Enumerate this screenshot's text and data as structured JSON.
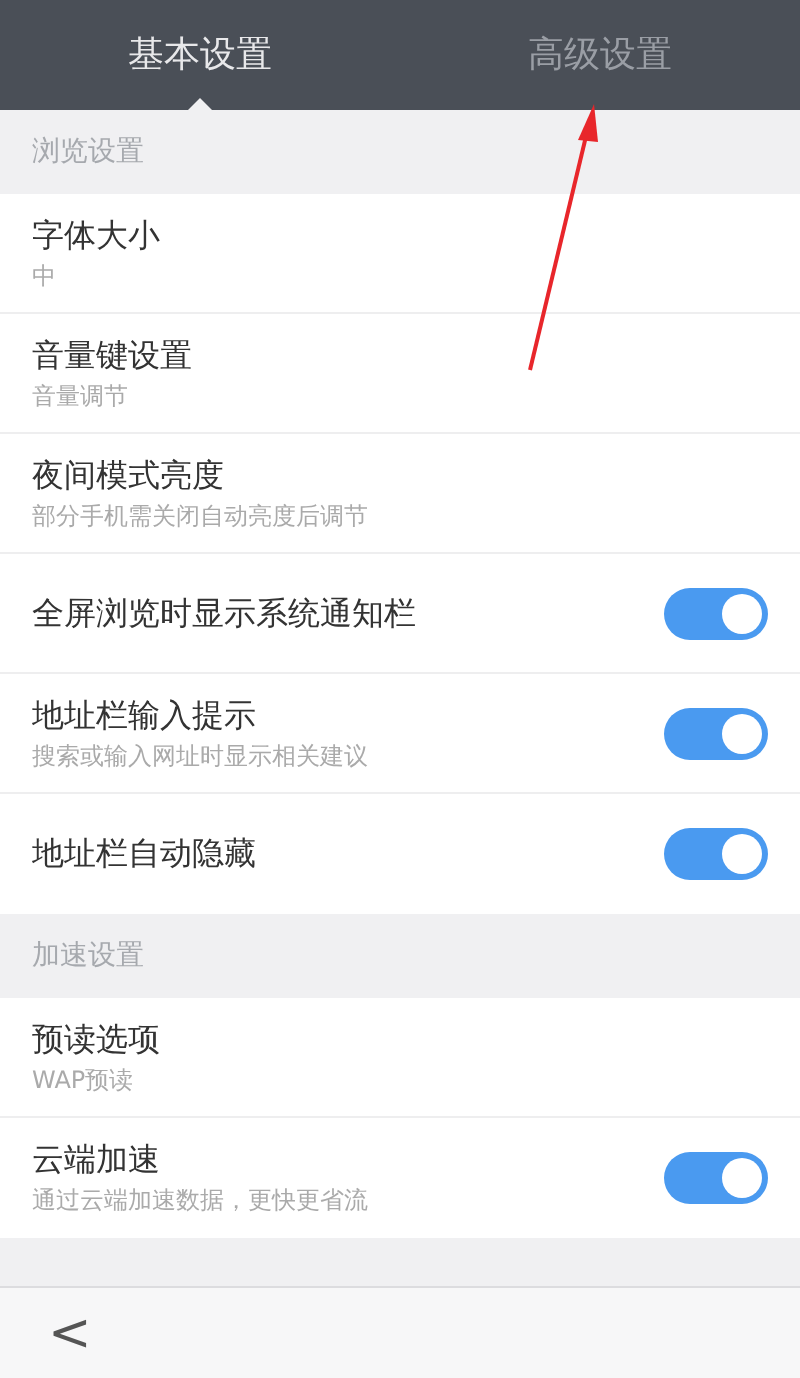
{
  "tabs": [
    {
      "label": "基本设置",
      "selected": true
    },
    {
      "label": "高级设置",
      "selected": false
    }
  ],
  "sections": [
    {
      "title": "浏览设置",
      "items": [
        {
          "kind": "nav",
          "label": "字体大小",
          "subtitle": "中"
        },
        {
          "kind": "nav",
          "label": "音量键设置",
          "subtitle": "音量调节"
        },
        {
          "kind": "nav",
          "label": "夜间模式亮度",
          "subtitle": "部分手机需关闭自动亮度后调节"
        },
        {
          "kind": "toggle",
          "label": "全屏浏览时显示系统通知栏",
          "on": true
        },
        {
          "kind": "toggle",
          "label": "地址栏输入提示",
          "subtitle": "搜索或输入网址时显示相关建议",
          "on": true
        },
        {
          "kind": "toggle",
          "label": "地址栏自动隐藏",
          "on": true
        }
      ]
    },
    {
      "title": "加速设置",
      "items": [
        {
          "kind": "nav",
          "label": "预读选项",
          "subtitle": "WAP预读"
        },
        {
          "kind": "toggle",
          "label": "云端加速",
          "subtitle": "通过云端加速数据，更快更省流",
          "on": true
        }
      ]
    }
  ],
  "bottom_bar": {
    "back": "<"
  }
}
